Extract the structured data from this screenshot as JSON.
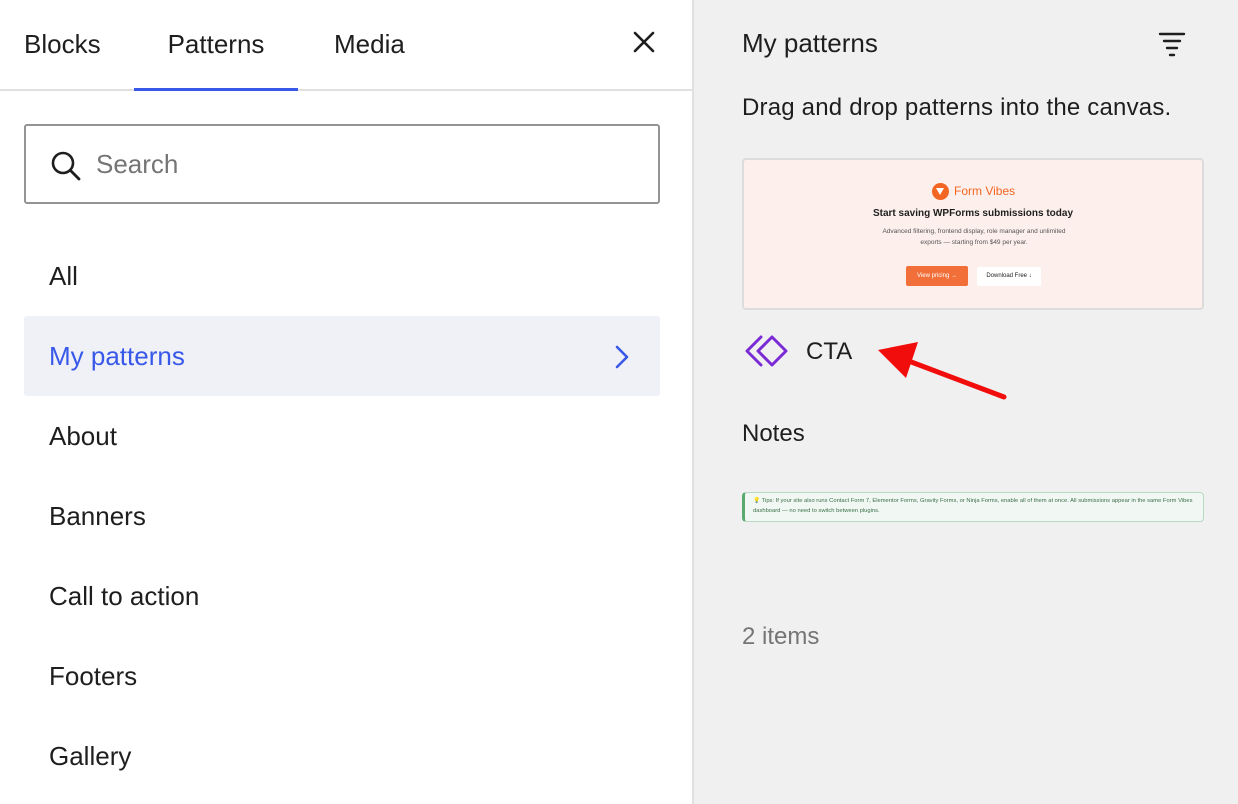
{
  "tabs": [
    {
      "label": "Blocks"
    },
    {
      "label": "Patterns"
    },
    {
      "label": "Media"
    }
  ],
  "search": {
    "placeholder": "Search",
    "value": ""
  },
  "categories": [
    {
      "label": "All"
    },
    {
      "label": "My patterns"
    },
    {
      "label": "About"
    },
    {
      "label": "Banners"
    },
    {
      "label": "Call to action"
    },
    {
      "label": "Footers"
    },
    {
      "label": "Gallery"
    }
  ],
  "panel": {
    "title": "My patterns",
    "description": "Drag and drop patterns into the canvas.",
    "preview": {
      "brand": "Form Vibes",
      "heading": "Start saving WPForms submissions today",
      "subtext": "Advanced filtering, frontend display, role manager and unlimited exports — starting from $49 per year.",
      "primary_button": "View pricing →",
      "secondary_button": "Download Free ↓"
    },
    "pattern_label": "CTA",
    "notes_label": "Notes",
    "notes_preview": "💡 Tips: If your site also runs Contact Form 7, Elementor Forms, Gravity Forms, or Ninja Forms, enable all of them at once. All submissions appear in the same Form Vibes dashboard — no need to switch between plugins.",
    "item_count": "2 items"
  },
  "colors": {
    "accent": "#3858e9",
    "pattern_icon": "#7b2bd6",
    "annotation_arrow": "#f20d0d",
    "brand_orange": "#f26522"
  },
  "icons": {
    "close": "close-icon",
    "search": "search-icon",
    "chevron": "chevron-right-icon",
    "filter": "filter-icon",
    "synced_pattern": "synced-pattern-icon"
  }
}
